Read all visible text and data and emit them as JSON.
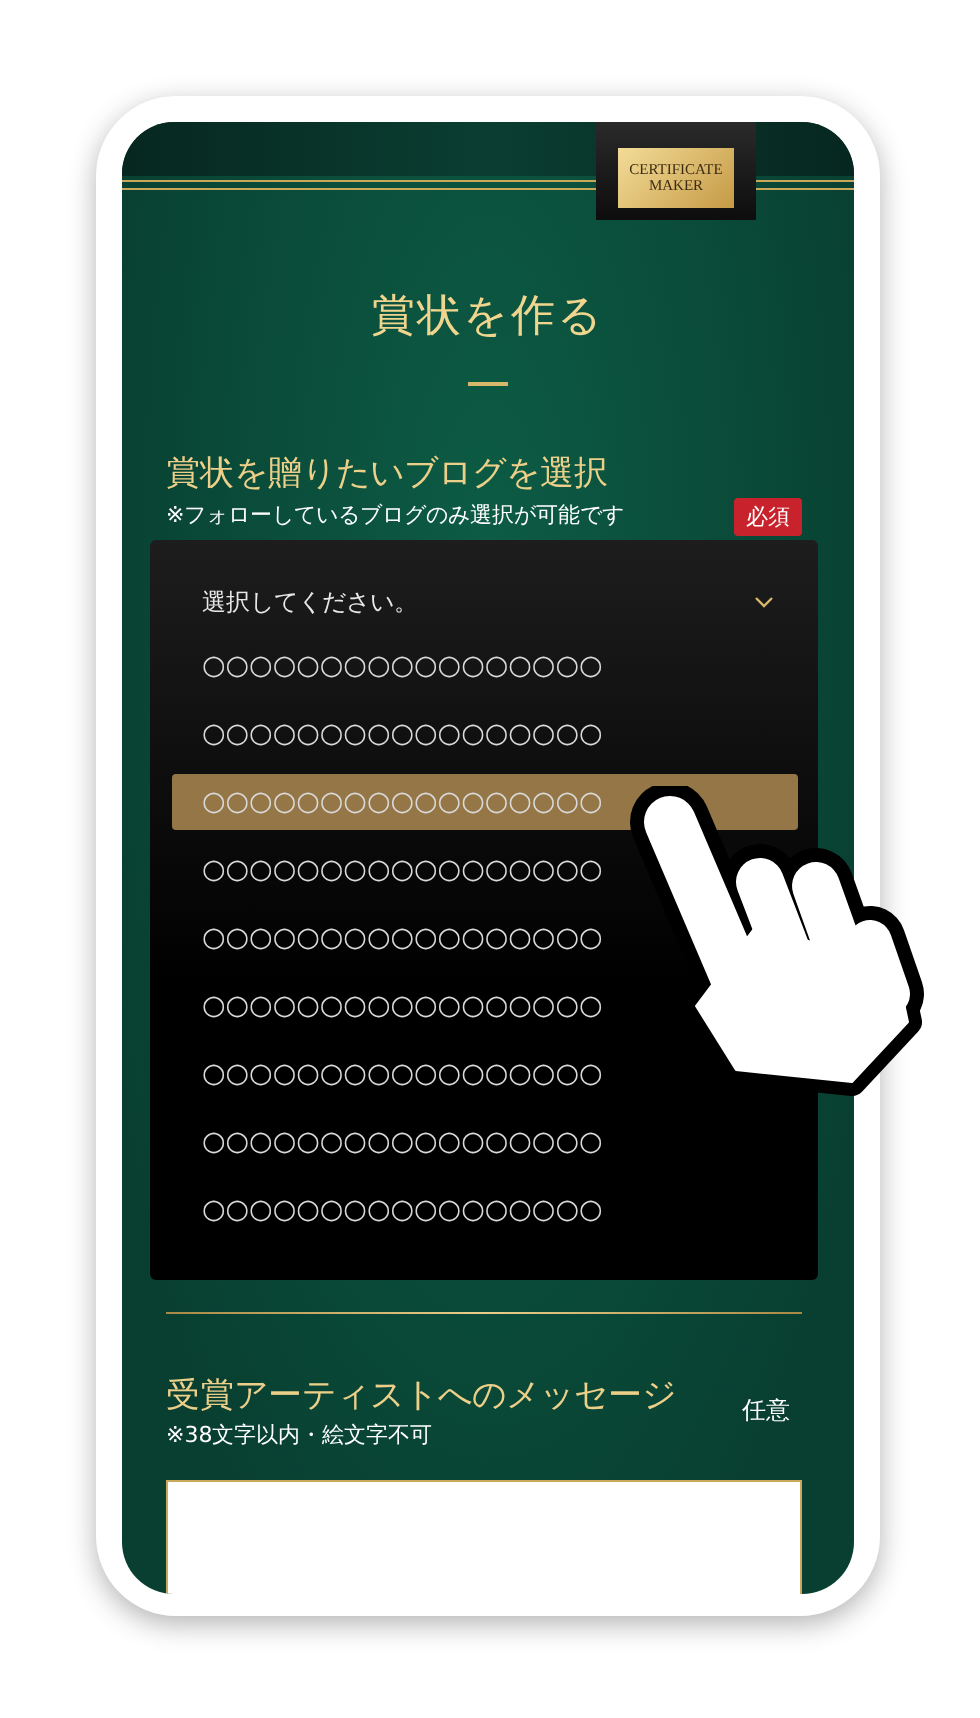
{
  "logo": {
    "line_1": "CERTIFICATE",
    "line_2": "MAKER"
  },
  "title": "賞状を作る",
  "blog_section": {
    "label": "賞状を贈りたいブログを選択",
    "note": "※フォローしているブログのみ選択が可能です",
    "badge": "必須"
  },
  "dropdown": {
    "placeholder": "選択してください。",
    "options": [
      {
        "label": "○○○○○○○○○○○○○○○○○",
        "selected": false
      },
      {
        "label": "○○○○○○○○○○○○○○○○○",
        "selected": false
      },
      {
        "label": "○○○○○○○○○○○○○○○○○",
        "selected": true
      },
      {
        "label": "○○○○○○○○○○○○○○○○○",
        "selected": false
      },
      {
        "label": "○○○○○○○○○○○○○○○○○",
        "selected": false
      },
      {
        "label": "○○○○○○○○○○○○○○○○○",
        "selected": false
      },
      {
        "label": "○○○○○○○○○○○○○○○○○",
        "selected": false
      },
      {
        "label": "○○○○○○○○○○○○○○○○○",
        "selected": false
      },
      {
        "label": "○○○○○○○○○○○○○○○○○",
        "selected": false
      }
    ]
  },
  "message_section": {
    "label": "受賞アーティストへのメッセージ",
    "note": "※38文字以内・絵文字不可",
    "badge": "任意"
  }
}
